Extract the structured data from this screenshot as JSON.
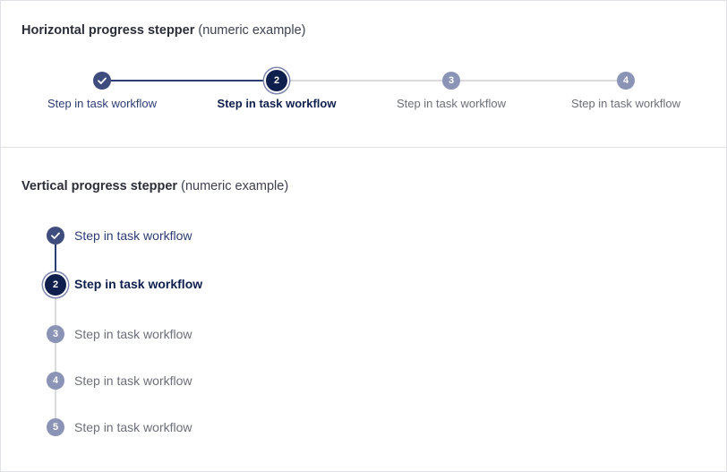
{
  "horizontal": {
    "title_bold": "Horizontal progress stepper",
    "title_rest": "(numeric example)",
    "steps": [
      {
        "number": "1",
        "label": "Step in task workflow",
        "state": "done"
      },
      {
        "number": "2",
        "label": "Step in task workflow",
        "state": "current"
      },
      {
        "number": "3",
        "label": "Step in task workflow",
        "state": "todo"
      },
      {
        "number": "4",
        "label": "Step in task workflow",
        "state": "todo"
      }
    ]
  },
  "vertical": {
    "title_bold": "Vertical progress stepper",
    "title_rest": "(numeric example)",
    "steps": [
      {
        "number": "1",
        "label": "Step in task workflow",
        "state": "done"
      },
      {
        "number": "2",
        "label": "Step in task workflow",
        "state": "current"
      },
      {
        "number": "3",
        "label": "Step in task workflow",
        "state": "todo"
      },
      {
        "number": "4",
        "label": "Step in task workflow",
        "state": "todo"
      },
      {
        "number": "5",
        "label": "Step in task workflow",
        "state": "todo"
      }
    ]
  },
  "colors": {
    "done": "#3f4d7e",
    "current": "#0f1f4d",
    "todo": "#8b93b6",
    "line_done": "#2c3c74",
    "line_todo": "#d9dbe1"
  },
  "icons": {
    "done": "check-icon"
  }
}
